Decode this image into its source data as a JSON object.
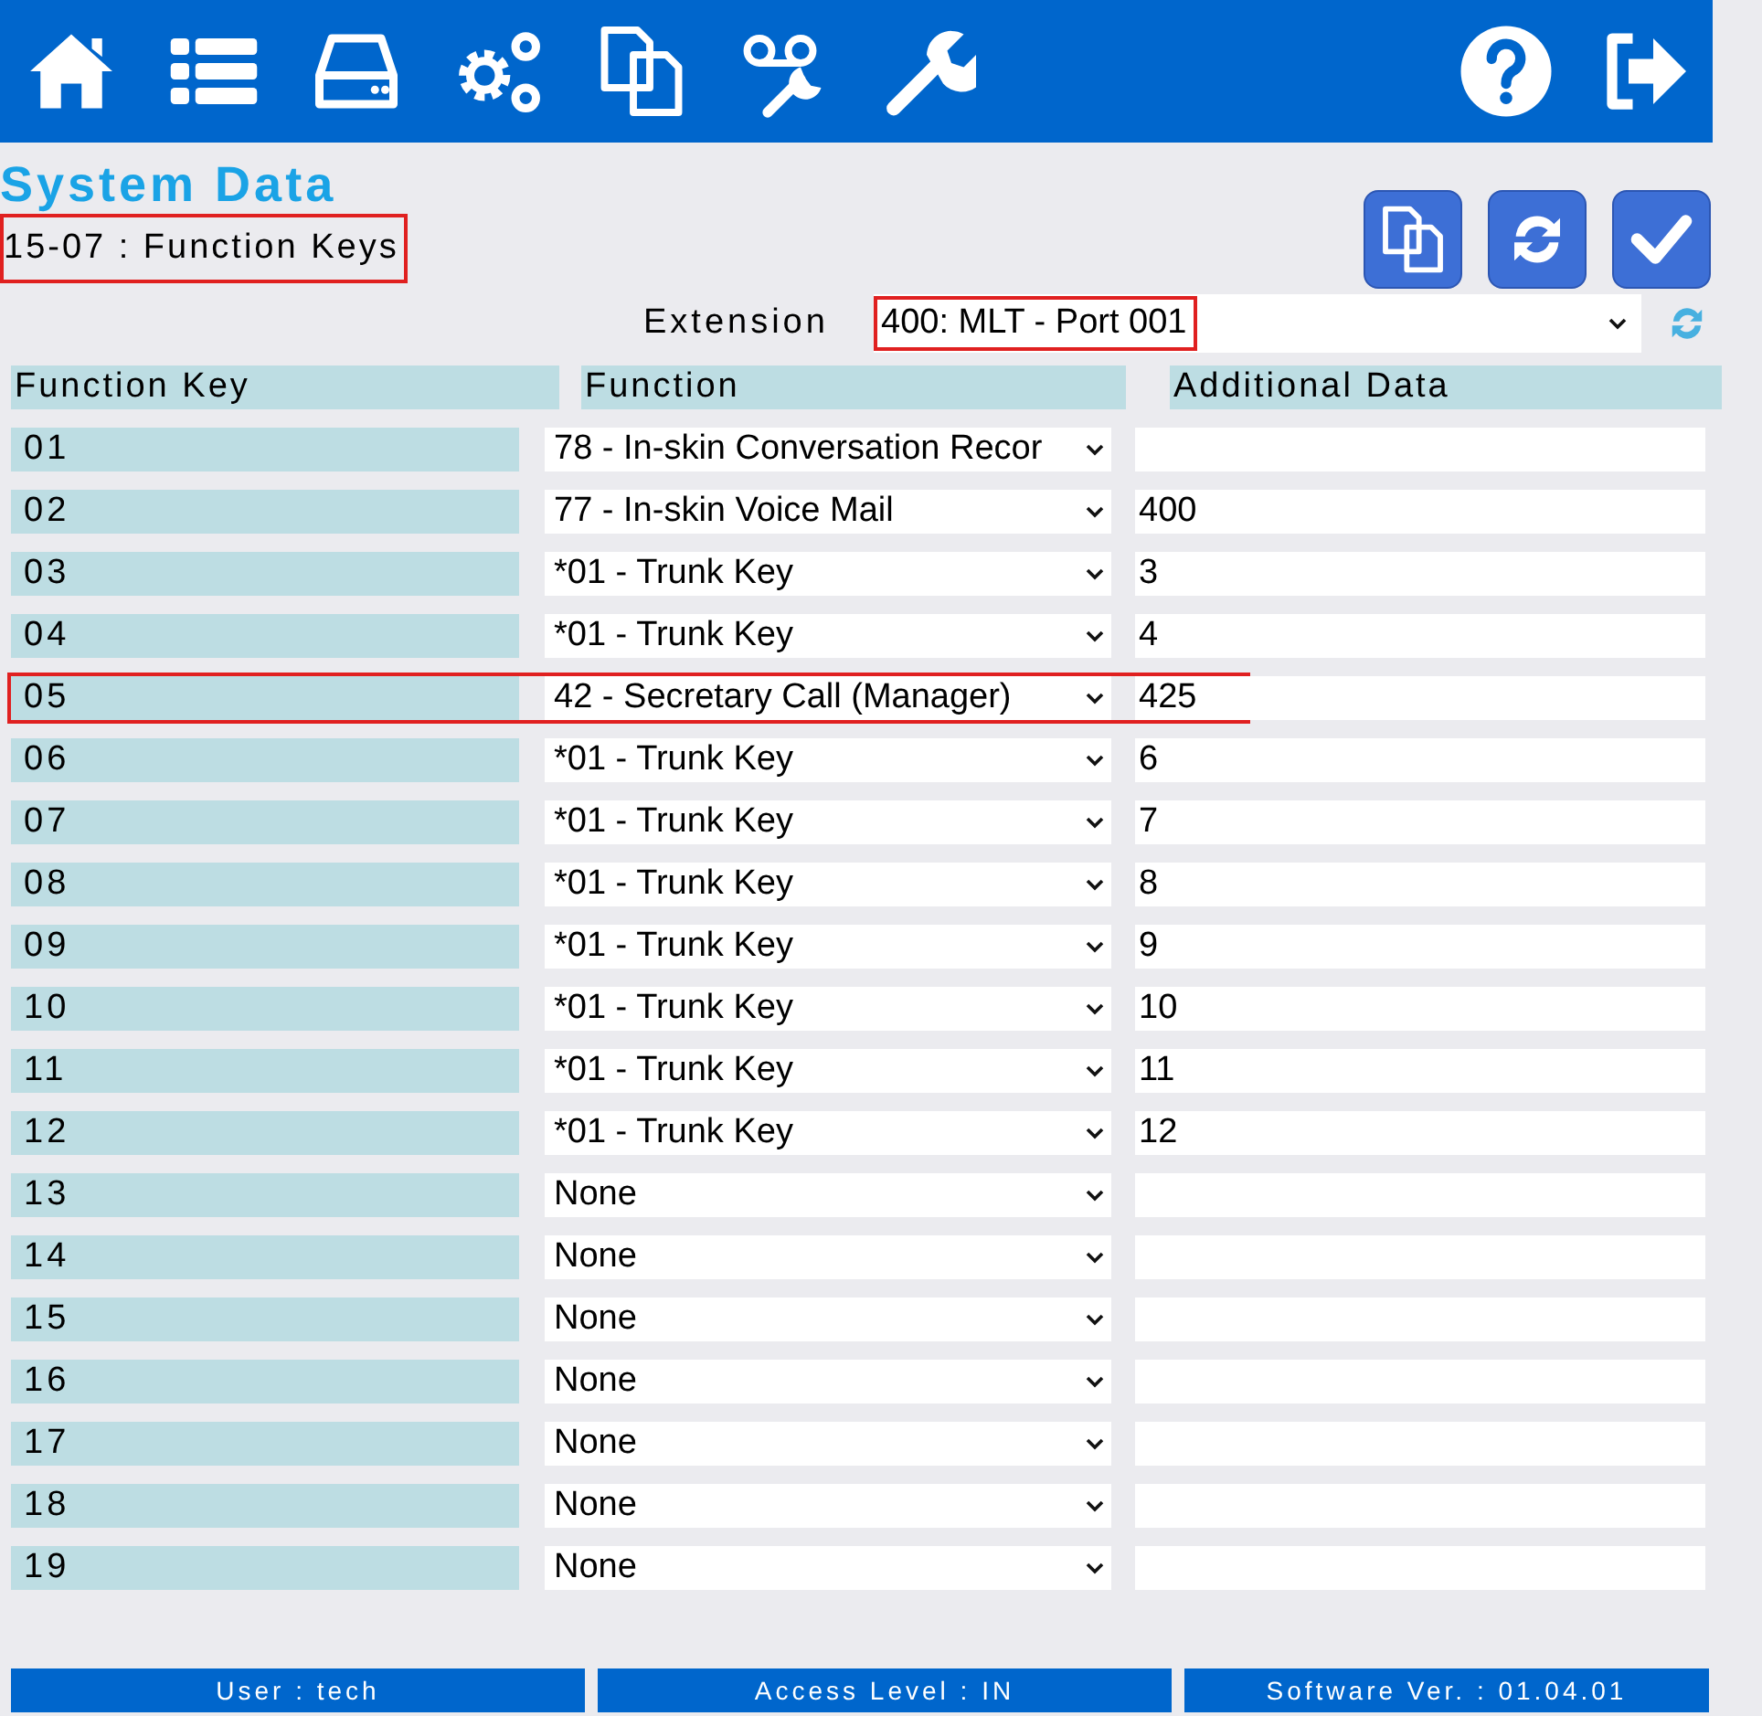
{
  "toolbar": {
    "left_icons": [
      {
        "kind": "home"
      },
      {
        "kind": "list"
      },
      {
        "kind": "drive"
      },
      {
        "kind": "gears"
      },
      {
        "kind": "copy"
      },
      {
        "kind": "voicemail"
      },
      {
        "kind": "wrench"
      }
    ],
    "right_icons": [
      {
        "kind": "help"
      },
      {
        "kind": "logout"
      }
    ]
  },
  "page": {
    "title": "System Data",
    "subtitle": "15-07 : Function Keys",
    "subtitle_highlighted": true,
    "actions": [
      {
        "kind": "copy"
      },
      {
        "kind": "refresh"
      },
      {
        "kind": "apply"
      }
    ]
  },
  "extension": {
    "label": "Extension",
    "value": "400: MLT - Port 001",
    "highlighted": true
  },
  "table": {
    "columns": [
      "Function Key",
      "Function",
      "Additional Data"
    ],
    "rows": [
      {
        "key": "01",
        "function": "78 - In-skin Conversation Recor",
        "data": "",
        "highlighted": false
      },
      {
        "key": "02",
        "function": "77 - In-skin Voice Mail",
        "data": "400",
        "highlighted": false
      },
      {
        "key": "03",
        "function": "*01 - Trunk Key",
        "data": "3",
        "highlighted": false
      },
      {
        "key": "04",
        "function": "*01 - Trunk Key",
        "data": "4",
        "highlighted": false
      },
      {
        "key": "05",
        "function": "42 - Secretary Call (Manager)",
        "data": "425",
        "highlighted": true
      },
      {
        "key": "06",
        "function": "*01 - Trunk Key",
        "data": "6",
        "highlighted": false
      },
      {
        "key": "07",
        "function": "*01 - Trunk Key",
        "data": "7",
        "highlighted": false
      },
      {
        "key": "08",
        "function": "*01 - Trunk Key",
        "data": "8",
        "highlighted": false
      },
      {
        "key": "09",
        "function": "*01 - Trunk Key",
        "data": "9",
        "highlighted": false
      },
      {
        "key": "10",
        "function": "*01 - Trunk Key",
        "data": "10",
        "highlighted": false
      },
      {
        "key": "11",
        "function": "*01 - Trunk Key",
        "data": "11",
        "highlighted": false
      },
      {
        "key": "12",
        "function": "*01 - Trunk Key",
        "data": "12",
        "highlighted": false
      },
      {
        "key": "13",
        "function": "None",
        "data": "",
        "highlighted": false
      },
      {
        "key": "14",
        "function": "None",
        "data": "",
        "highlighted": false
      },
      {
        "key": "15",
        "function": "None",
        "data": "",
        "highlighted": false
      },
      {
        "key": "16",
        "function": "None",
        "data": "",
        "highlighted": false
      },
      {
        "key": "17",
        "function": "None",
        "data": "",
        "highlighted": false
      },
      {
        "key": "18",
        "function": "None",
        "data": "",
        "highlighted": false
      },
      {
        "key": "19",
        "function": "None",
        "data": "",
        "highlighted": false
      }
    ]
  },
  "status_bar": [
    "User : tech",
    "Access Level : IN",
    "Software Ver. : 01.04.01"
  ]
}
